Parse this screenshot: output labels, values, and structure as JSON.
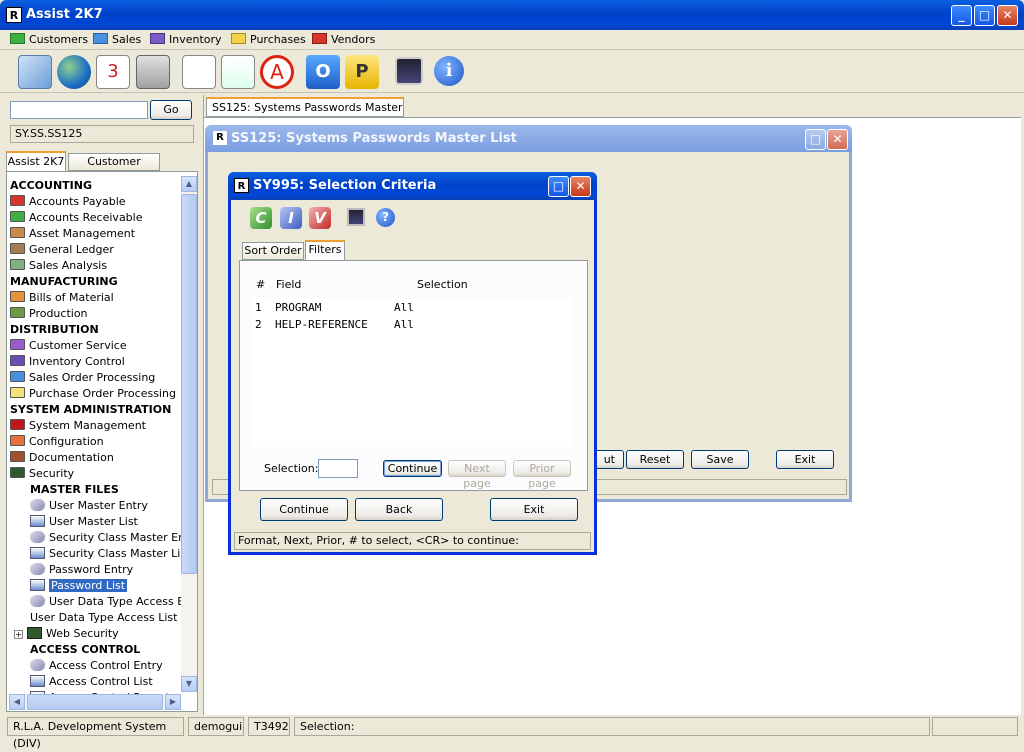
{
  "app": {
    "title": "Assist 2K7"
  },
  "menubar": [
    {
      "label": "Customers",
      "color": "#3cb043"
    },
    {
      "label": "Sales",
      "color": "#4a90e2"
    },
    {
      "label": "Inventory",
      "color": "#7b5cc6"
    },
    {
      "label": "Purchases",
      "color": "#f2d34a"
    },
    {
      "label": "Vendors",
      "color": "#d9342b"
    }
  ],
  "search": {
    "value": "",
    "go_label": "Go",
    "path": "SY.SS.SS125"
  },
  "left_tabs": [
    "Assist 2K7",
    "Customer Service"
  ],
  "tree": {
    "accounting": "ACCOUNTING",
    "ap": "Accounts Payable",
    "ar": "Accounts Receivable",
    "am": "Asset Management",
    "gl": "General Ledger",
    "sa": "Sales Analysis",
    "manufacturing": "MANUFACTURING",
    "bom": "Bills of Material",
    "prod": "Production",
    "distribution": "DISTRIBUTION",
    "cs": "Customer Service",
    "ic": "Inventory Control",
    "sop": "Sales Order Processing",
    "pop": "Purchase Order Processing",
    "sysadmin": "SYSTEM ADMINISTRATION",
    "sm": "System Management",
    "config": "Configuration",
    "doc": "Documentation",
    "security": "Security",
    "master_files": "MASTER FILES",
    "ume": "User Master Entry",
    "uml": "User Master List",
    "scme": "Security Class Master Entry",
    "scml": "Security Class Master List",
    "pe": "Password Entry",
    "pl": "Password List",
    "udtae": "User Data Type Access Ent",
    "udtal": "User Data Type Access List",
    "web": "Web Security",
    "access_control": "ACCESS CONTROL",
    "ace": "Access Control Entry",
    "acl": "Access Control List",
    "acr": "Access Control Report"
  },
  "doc_tab": {
    "label": "SS125: Systems Passwords Master List"
  },
  "win_ss125": {
    "title": "SS125: Systems Passwords Master List",
    "buttons": [
      "ut",
      "Reset",
      "Save",
      "Exit"
    ]
  },
  "dialog": {
    "title": "SY995: Selection Criteria",
    "tabs": [
      "Sort Order",
      "Filters"
    ],
    "headers": {
      "num": "#",
      "field": "Field",
      "selection": "Selection"
    },
    "rows": [
      {
        "num": "1",
        "field": "PROGRAM",
        "selection": "All"
      },
      {
        "num": "2",
        "field": "HELP-REFERENCE",
        "selection": "All"
      }
    ],
    "selection_label": "Selection:",
    "selection_value": "",
    "continue_small": "Continue",
    "next_page": "Next page",
    "prior_page": "Prior page",
    "continue": "Continue",
    "back": "Back",
    "exit": "Exit",
    "status": "Format,  Next,  Prior,  # to select,  <CR> to continue:"
  },
  "statusbar": {
    "system": "R.L.A. Development System (DIV)",
    "user": "demogui",
    "terminal": "T3492",
    "selection": "Selection:"
  }
}
